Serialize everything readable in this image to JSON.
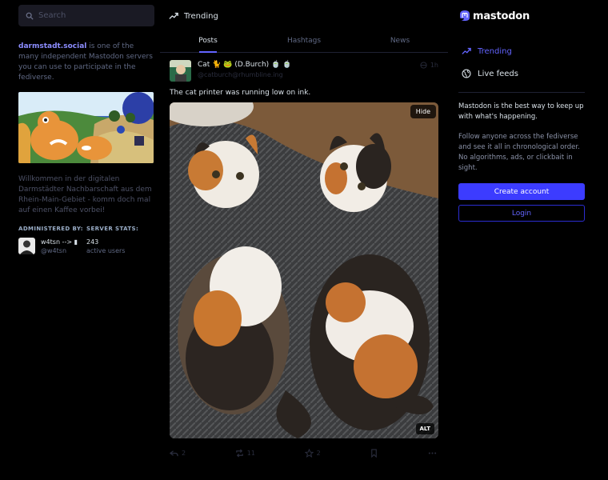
{
  "search": {
    "placeholder": "Search"
  },
  "server": {
    "domain": "darmstadt.social",
    "intro_rest": " is one of the many independent Mastodon servers you can use to participate in the fediverse.",
    "welcome": "Willkommen in der digitalen Darmstädter Nachbarschaft aus dem Rhein-Main-Gebiet - komm doch mal auf einen Kaffee vorbei!",
    "administered_by_label": "ADMINISTERED BY:",
    "server_stats_label": "SERVER STATS:",
    "admin_name": "w4tsn --> ▮",
    "admin_handle": "@w4tsn",
    "active_users_count": "243",
    "active_users_label": "active users"
  },
  "column": {
    "title": "Trending",
    "icon": "trending-icon"
  },
  "tabs": [
    {
      "label": "Posts",
      "active": true
    },
    {
      "label": "Hashtags",
      "active": false
    },
    {
      "label": "News",
      "active": false
    }
  ],
  "post": {
    "display_name": "Cat 🐈 🐸 (D.Burch) 🍵 🍵",
    "handle": "@catburch@rhumbline.ing",
    "time": "1h",
    "text": "The cat printer was running low on ink.",
    "hide_label": "Hide",
    "alt_label": "ALT",
    "replies": "2",
    "boosts": "11",
    "favourites": "2"
  },
  "brand": {
    "name": "mastodon",
    "accent": "#6364ff"
  },
  "nav": [
    {
      "label": "Trending",
      "icon": "trending-icon",
      "active": true
    },
    {
      "label": "Live feeds",
      "icon": "globe-icon",
      "active": false
    }
  ],
  "about": {
    "line1": "Mastodon is the best way to keep up with what's happening.",
    "line2": "Follow anyone across the fediverse and see it all in chronological order. No algorithms, ads, or clickbait in sight.",
    "create_account": "Create account",
    "login": "Login"
  }
}
